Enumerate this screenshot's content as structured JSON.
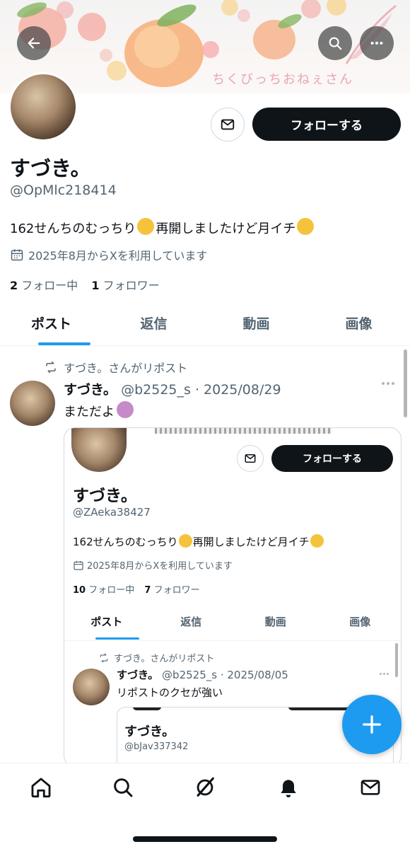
{
  "banner": {
    "text": "ちくびっちおねぇさん"
  },
  "profile": {
    "name": "すづき。",
    "handle": "@OpMlc218414",
    "bio": "162せんちのむっちり",
    "bio_tail": "再開しましたけど月イチ",
    "joined": "2025年8月からXを利用しています",
    "following_count": "2",
    "following_label": "フォロー中",
    "followers_count": "1",
    "followers_label": "フォロワー",
    "follow_label": "フォローする"
  },
  "tabs": [
    {
      "label": "ポスト"
    },
    {
      "label": "返信"
    },
    {
      "label": "動画"
    },
    {
      "label": "画像"
    }
  ],
  "post": {
    "repost_label": "すづき。さんがリポスト",
    "name": "すづき。",
    "handle_date": "@b2525_s · 2025/08/29",
    "text": "まただよ"
  },
  "embed": {
    "name": "すづき。",
    "handle": "@ZAeka38427",
    "bio": "162せんちのむっちり",
    "bio_tail": "再開しましたけど月イチ",
    "joined": "2025年8月からXを利用しています",
    "following_count": "10",
    "following_label": "フォロー中",
    "followers_count": "7",
    "followers_label": "フォロワー",
    "follow_label": "フォローする",
    "tabs": [
      {
        "label": "ポスト"
      },
      {
        "label": "返信"
      },
      {
        "label": "動画"
      },
      {
        "label": "画像"
      }
    ],
    "post": {
      "repost_label": "すづき。さんがリポスト",
      "name": "すづき。",
      "handle_date": "@b2525_s · 2025/08/05",
      "text": "リポストのクセが強い"
    },
    "inner": {
      "name": "すづき。",
      "handle": "@bJav337342"
    }
  },
  "colors": {
    "accent": "#1d9bf0",
    "text": "#0f1419",
    "muted": "#536471"
  },
  "nav": [
    "home-icon",
    "search-icon",
    "grok-icon",
    "notifications-icon",
    "messages-icon"
  ]
}
